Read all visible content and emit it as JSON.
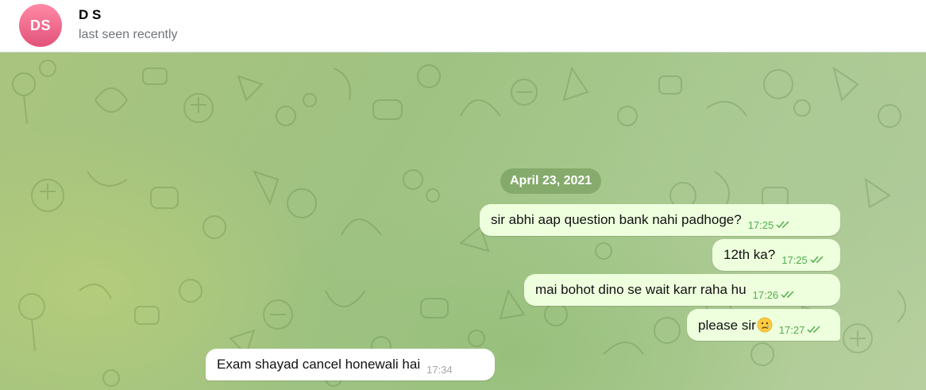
{
  "header": {
    "avatar_initials": "DS",
    "contact_name": "D S",
    "status": "last seen recently"
  },
  "chat": {
    "date_label": "April 23, 2021",
    "messages": [
      {
        "direction": "outgoing",
        "text": "sir abhi aap question bank nahi padhoge?",
        "time": "17:25",
        "read": true
      },
      {
        "direction": "outgoing",
        "text": "12th ka?",
        "time": "17:25",
        "read": true
      },
      {
        "direction": "outgoing",
        "text": "mai bohot dino se wait karr raha hu",
        "time": "17:26",
        "read": true
      },
      {
        "direction": "outgoing",
        "text": "please sir",
        "emoji": "crying-face-icon",
        "time": "17:27",
        "read": true
      },
      {
        "direction": "incoming",
        "text": "Exam shayad cancel honewali hai",
        "time": "17:34"
      }
    ]
  },
  "colors": {
    "outgoing_bubble": "#eeffde",
    "incoming_bubble": "#ffffff",
    "read_tick": "#4fae4e",
    "avatar_gradient": [
      "#ff8aa5",
      "#e2527b"
    ]
  }
}
